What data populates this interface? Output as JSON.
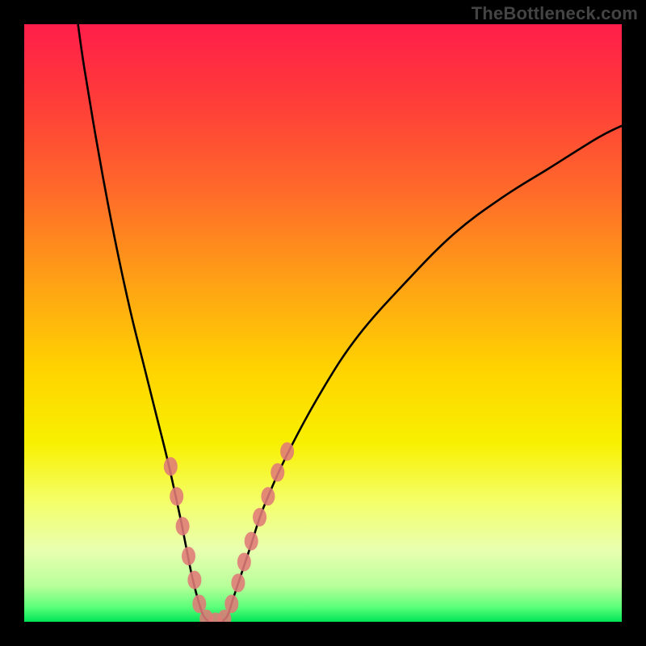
{
  "watermark": "TheBottleneck.com",
  "colors": {
    "frame": "#000000",
    "watermark": "#444444",
    "curve": "#000000",
    "markers": "#e07a78",
    "gradient_stops": [
      {
        "offset": 0.0,
        "color": "#ff1e4a"
      },
      {
        "offset": 0.12,
        "color": "#ff3a3a"
      },
      {
        "offset": 0.28,
        "color": "#ff6a2a"
      },
      {
        "offset": 0.44,
        "color": "#ffa414"
      },
      {
        "offset": 0.58,
        "color": "#ffd400"
      },
      {
        "offset": 0.7,
        "color": "#f8f000"
      },
      {
        "offset": 0.8,
        "color": "#f4ff6a"
      },
      {
        "offset": 0.88,
        "color": "#e8ffb0"
      },
      {
        "offset": 0.94,
        "color": "#b8ff9a"
      },
      {
        "offset": 0.975,
        "color": "#5cff7a"
      },
      {
        "offset": 1.0,
        "color": "#00e556"
      }
    ]
  },
  "chart_data": {
    "type": "line",
    "title": "",
    "xlabel": "",
    "ylabel": "",
    "xlim": [
      0,
      100
    ],
    "ylim": [
      0,
      100
    ],
    "note": "Values are approximate, read off the plotted curve in a 100×100 coordinate space (y=0 at top).",
    "series": [
      {
        "name": "bottleneck-curve-left",
        "x": [
          9,
          10,
          12,
          14,
          16,
          18,
          20,
          22,
          24,
          26,
          27,
          28,
          29,
          30,
          31
        ],
        "y": [
          0,
          7,
          19,
          30,
          40,
          49,
          57,
          65,
          73,
          82,
          87,
          92,
          96,
          99,
          100
        ]
      },
      {
        "name": "bottleneck-curve-right",
        "x": [
          33,
          34,
          35,
          36,
          38,
          40,
          44,
          50,
          56,
          64,
          72,
          80,
          88,
          96,
          100
        ],
        "y": [
          100,
          99,
          96,
          93,
          87,
          81,
          72,
          61,
          52,
          43,
          35,
          29,
          24,
          19,
          17
        ]
      }
    ],
    "markers": {
      "name": "highlight-dots",
      "points": [
        {
          "x": 24.5,
          "y": 74
        },
        {
          "x": 25.5,
          "y": 79
        },
        {
          "x": 26.5,
          "y": 84
        },
        {
          "x": 27.5,
          "y": 89
        },
        {
          "x": 28.5,
          "y": 93
        },
        {
          "x": 29.3,
          "y": 97
        },
        {
          "x": 30.5,
          "y": 99.5
        },
        {
          "x": 32.0,
          "y": 100
        },
        {
          "x": 33.5,
          "y": 99.5
        },
        {
          "x": 34.7,
          "y": 97
        },
        {
          "x": 35.8,
          "y": 93.5
        },
        {
          "x": 36.8,
          "y": 90
        },
        {
          "x": 38.0,
          "y": 86.5
        },
        {
          "x": 39.4,
          "y": 82.5
        },
        {
          "x": 40.8,
          "y": 79
        },
        {
          "x": 42.4,
          "y": 75
        },
        {
          "x": 44.0,
          "y": 71.5
        }
      ]
    }
  }
}
